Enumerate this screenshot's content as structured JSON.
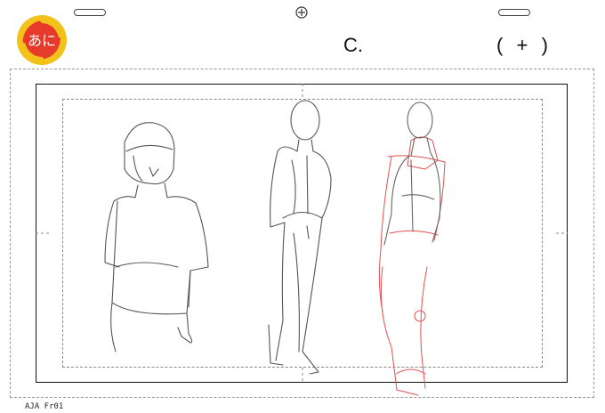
{
  "header": {
    "scene_label": "C.",
    "cut_number": "(  +  )"
  },
  "logo": {
    "glyph_text": "あに",
    "colors": {
      "ring": "#f2c21a",
      "inner": "#e63a2a",
      "glyph": "#ffffff"
    }
  },
  "icons": {
    "peg_left": "peg-hole-icon",
    "peg_right": "peg-hole-icon",
    "center": "crosshair-icon"
  },
  "footer": {
    "sheet_id": "AJA Fr01"
  },
  "colors": {
    "pencil": "#555555",
    "construction": "#e05050",
    "frame": "#111111"
  }
}
